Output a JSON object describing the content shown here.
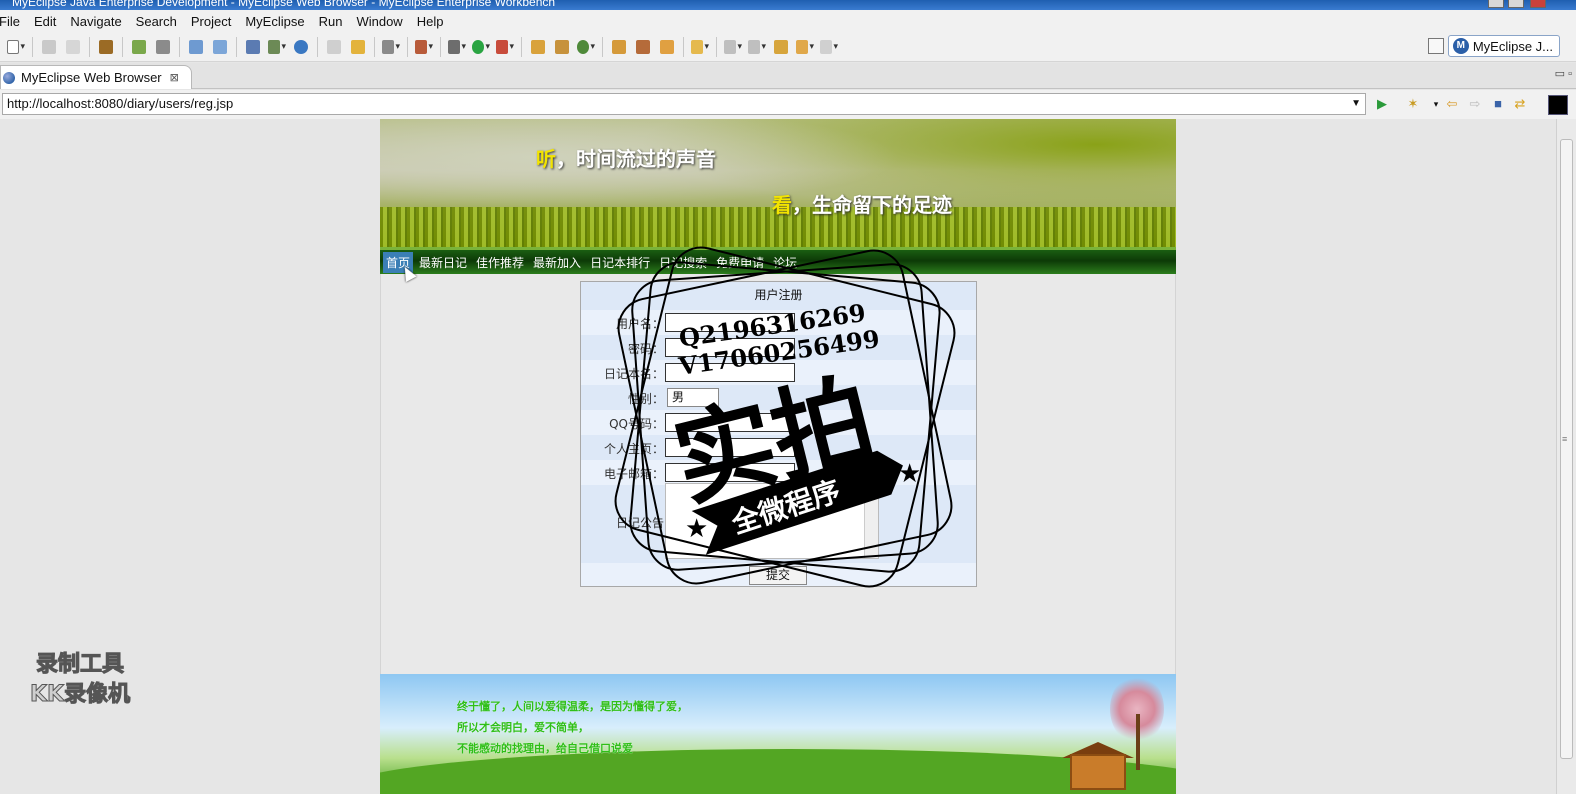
{
  "window": {
    "title": "MyEclipse Java Enterprise Development - MyEclipse Web Browser - MyEclipse Enterprise Workbench"
  },
  "menu": [
    "File",
    "Edit",
    "Navigate",
    "Search",
    "Project",
    "MyEclipse",
    "Run",
    "Window",
    "Help"
  ],
  "perspective": {
    "label": "MyEclipse J...",
    "badge": "M"
  },
  "editor_tab": {
    "label": "MyEclipse Web Browser",
    "close": "⊠"
  },
  "browser": {
    "url": "http://localhost:8080/diary/users/reg.jsp"
  },
  "page": {
    "banner": {
      "line1_highlight": "听",
      "line1_rest": "，时间流过的声音",
      "line2_highlight": "看",
      "line2_rest": "，生命留下的足迹"
    },
    "nav": [
      "首页",
      "最新日记",
      "佳作推荐",
      "最新加入",
      "日记本排行",
      "日记搜索",
      "免费申请",
      "论坛"
    ],
    "form": {
      "title": "用户注册",
      "labels": {
        "username": "用户名：",
        "password": "密码：",
        "diary_name": "日记本名：",
        "gender": "性别：",
        "qq": "QQ号码：",
        "homepage": "个人主页：",
        "email": "电子邮箱：",
        "notice": "日记公告"
      },
      "gender_value": "男",
      "submit": "提交"
    },
    "footer": [
      "终于懂了，人间以爱得温柔，是因为懂得了爱，",
      "所以才会明白，爱不简单，",
      "不能感动的找理由，给自己借口说爱"
    ]
  },
  "watermark": {
    "line_q": "Q2196316269",
    "line_v": "V17060256499",
    "big": "实拍",
    "ribbon": "全微程序"
  },
  "recorder": {
    "line1": "录制工具",
    "line2": "KK录像机"
  }
}
